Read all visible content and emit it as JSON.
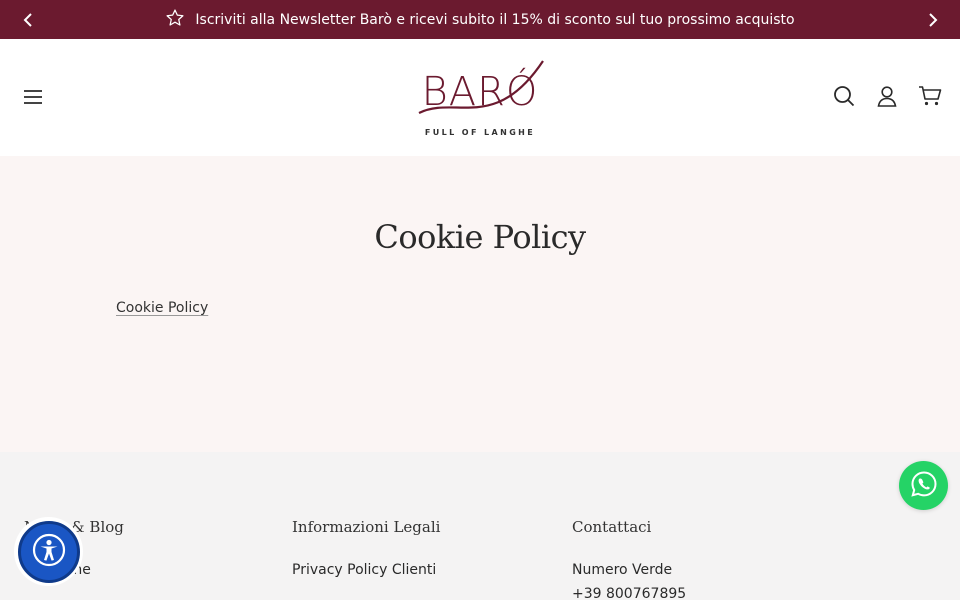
{
  "announcement": {
    "text": "Iscriviti alla Newsletter Barò e ricevi subito il 15% di sconto sul tuo prossimo acquisto",
    "prev_icon": "chevron-left-icon",
    "next_icon": "chevron-right-icon",
    "star_icon": "star-icon"
  },
  "header": {
    "logo_main": "BARÓ",
    "logo_tagline": "FULL OF LANGHE",
    "menu_icon": "hamburger-icon",
    "search_icon": "search-icon",
    "account_icon": "user-icon",
    "cart_icon": "cart-icon"
  },
  "content": {
    "title": "Cookie Policy",
    "link": "Cookie Policy"
  },
  "footer": {
    "col1": {
      "heading": "News & Blog",
      "items": [
        "Magazine"
      ]
    },
    "col2": {
      "heading": "Informazioni Legali",
      "items": [
        "Privacy Policy Clienti"
      ]
    },
    "col3": {
      "heading": "Contattaci",
      "items": [
        "Numero Verde",
        "+39 800767895"
      ]
    }
  },
  "colors": {
    "brand": "#6b1a2f",
    "whatsapp": "#25d366",
    "accessibility": "#1a56c4"
  }
}
